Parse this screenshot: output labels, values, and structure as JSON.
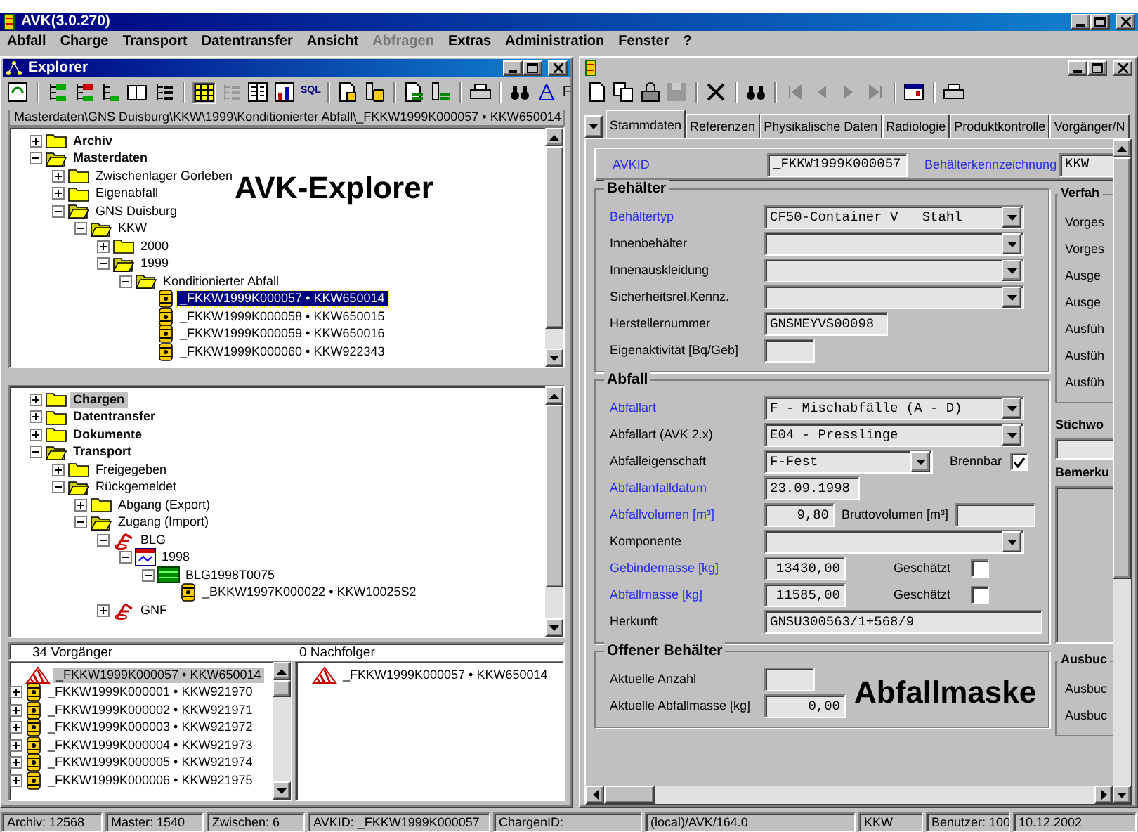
{
  "app": {
    "title": "AVK(3.0.270)"
  },
  "menu": [
    {
      "label": "Abfall",
      "disabled": false
    },
    {
      "label": "Charge",
      "disabled": false
    },
    {
      "label": "Transport",
      "disabled": false
    },
    {
      "label": "Datentransfer",
      "disabled": false
    },
    {
      "label": "Ansicht",
      "disabled": false
    },
    {
      "label": "Abfragen",
      "disabled": true
    },
    {
      "label": "Extras",
      "disabled": false
    },
    {
      "label": "Administration",
      "disabled": false
    },
    {
      "label": "Fenster",
      "disabled": false
    },
    {
      "label": "?",
      "disabled": false
    }
  ],
  "explorer": {
    "title": "Explorer",
    "toolbar_sql": "SQL",
    "toolbar_overflow": "F",
    "path": "Masterdaten\\GNS Duisburg\\KKW\\1999\\Konditionierter Abfall\\_FKKW1999K000057 • KKW650014",
    "overlay_label": "AVK-Explorer",
    "tree_top": {
      "focused": true,
      "nodes": [
        {
          "label": "Archiv",
          "kind": "folder",
          "bold": true,
          "expanded": false,
          "selected": false
        },
        {
          "label": "Masterdaten",
          "kind": "folder-open",
          "bold": true,
          "expanded": true,
          "selected": false,
          "children": [
            {
              "label": "Zwischenlager Gorleben",
              "kind": "folder",
              "bold": false,
              "expanded": false,
              "selected": false
            },
            {
              "label": "Eigenabfall",
              "kind": "folder",
              "bold": false,
              "expanded": false,
              "selected": false
            },
            {
              "label": "GNS Duisburg",
              "kind": "folder-open",
              "bold": false,
              "expanded": true,
              "selected": false,
              "children": [
                {
                  "label": "KKW",
                  "kind": "folder-open",
                  "bold": false,
                  "expanded": true,
                  "selected": false,
                  "children": [
                    {
                      "label": "2000",
                      "kind": "folder",
                      "bold": false,
                      "expanded": false,
                      "selected": false
                    },
                    {
                      "label": "1999",
                      "kind": "folder-open",
                      "bold": false,
                      "expanded": true,
                      "selected": false,
                      "children": [
                        {
                          "label": "Konditionierter Abfall",
                          "kind": "folder-open",
                          "bold": false,
                          "expanded": true,
                          "selected": false,
                          "children": [
                            {
                              "label": "_FKKW1999K000057 • KKW650014",
                              "kind": "drum",
                              "bold": false,
                              "selected": true
                            },
                            {
                              "label": "_FKKW1999K000058 • KKW650015",
                              "kind": "drum",
                              "bold": false,
                              "selected": false
                            },
                            {
                              "label": "_FKKW1999K000059 • KKW650016",
                              "kind": "drum",
                              "bold": false,
                              "selected": false
                            },
                            {
                              "label": "_FKKW1999K000060 • KKW922343",
                              "kind": "drum",
                              "bold": false,
                              "selected": false
                            }
                          ]
                        }
                      ]
                    }
                  ]
                }
              ]
            }
          ]
        }
      ]
    },
    "tree_bottom": {
      "focused": false,
      "nodes": [
        {
          "label": "Chargen",
          "kind": "folder",
          "bold": true,
          "expanded": false,
          "selected": true
        },
        {
          "label": "Datentransfer",
          "kind": "folder",
          "bold": true,
          "expanded": false,
          "selected": false
        },
        {
          "label": "Dokumente",
          "kind": "folder",
          "bold": true,
          "expanded": false,
          "selected": false
        },
        {
          "label": "Transport",
          "kind": "folder-open",
          "bold": true,
          "expanded": true,
          "selected": false,
          "children": [
            {
              "label": "Freigegeben",
              "kind": "folder",
              "bold": false,
              "expanded": false,
              "selected": false
            },
            {
              "label": "Rückgemeldet",
              "kind": "folder-open",
              "bold": false,
              "expanded": true,
              "selected": false,
              "children": [
                {
                  "label": "Abgang (Export)",
                  "kind": "folder",
                  "bold": false,
                  "expanded": false,
                  "selected": false
                },
                {
                  "label": "Zugang (Import)",
                  "kind": "folder-open",
                  "bold": false,
                  "expanded": true,
                  "selected": false,
                  "children": [
                    {
                      "label": "BLG",
                      "kind": "site",
                      "bold": false,
                      "expanded": true,
                      "selected": false,
                      "children": [
                        {
                          "label": "1998",
                          "kind": "calendar",
                          "bold": false,
                          "expanded": true,
                          "selected": false,
                          "children": [
                            {
                              "label": "BLG1998T0075",
                              "kind": "batch",
                              "bold": false,
                              "expanded": true,
                              "selected": false,
                              "children": [
                                {
                                  "label": "_BKKW1997K000022 • KKW10025S2",
                                  "kind": "drum",
                                  "bold": false,
                                  "selected": false
                                }
                              ]
                            }
                          ]
                        }
                      ]
                    },
                    {
                      "label": "GNF",
                      "kind": "site",
                      "bold": false,
                      "expanded": false,
                      "selected": false
                    }
                  ]
                }
              ]
            }
          ]
        }
      ]
    },
    "predecessors": {
      "header": "34 Vorgänger",
      "items": [
        {
          "label": "_FKKW1999K000057 • KKW650014",
          "kind": "hazard",
          "selected": true
        },
        {
          "label": "_FKKW1999K000001 • KKW921970",
          "kind": "drum",
          "expanded": false,
          "selected": false
        },
        {
          "label": "_FKKW1999K000002 • KKW921971",
          "kind": "drum",
          "expanded": false,
          "selected": false
        },
        {
          "label": "_FKKW1999K000003 • KKW921972",
          "kind": "drum",
          "expanded": false,
          "selected": false
        },
        {
          "label": "_FKKW1999K000004 • KKW921973",
          "kind": "drum",
          "expanded": false,
          "selected": false
        },
        {
          "label": "_FKKW1999K000005 • KKW921974",
          "kind": "drum",
          "expanded": false,
          "selected": false
        },
        {
          "label": "_FKKW1999K000006 • KKW921975",
          "kind": "drum",
          "expanded": false,
          "selected": false
        }
      ]
    },
    "successors": {
      "header": "0 Nachfolger",
      "items": [
        {
          "label": "_FKKW1999K000057 • KKW650014",
          "kind": "hazard",
          "selected": false
        }
      ]
    }
  },
  "form": {
    "tabs": [
      {
        "label": "Stammdaten",
        "selected": true
      },
      {
        "label": "Referenzen",
        "selected": false
      },
      {
        "label": "Physikalische Daten",
        "selected": false
      },
      {
        "label": "Radiologie",
        "selected": false
      },
      {
        "label": "Produktkontrolle",
        "selected": false
      },
      {
        "label": "Vorgänger/N",
        "selected": false
      }
    ],
    "id_row": {
      "label": "AVKID",
      "value": "_FKKW1999K000057",
      "label_2": "Behälterkennzeichnung",
      "value_2": "KKW"
    },
    "groups": [
      {
        "title": "Behälter",
        "rows": [
          {
            "label": "Behältertyp",
            "required": true,
            "kind": "combo",
            "value": "CF50-Container V   Stahl"
          },
          {
            "label": "Innenbehälter",
            "required": false,
            "kind": "combo"
          },
          {
            "label": "Innenauskleidung",
            "required": false,
            "kind": "combo"
          },
          {
            "label": "Sicherheitsrel.Kennz.",
            "required": false,
            "kind": "combo"
          },
          {
            "label": "Herstellernummer",
            "required": false,
            "kind": "text",
            "value": "GNSMEYVS00098"
          },
          {
            "label": "Eigenaktivität [Bq/Geb]",
            "required": false,
            "kind": "short"
          }
        ]
      },
      {
        "title": "Abfall",
        "rows": [
          {
            "label": "Abfallart",
            "required": true,
            "kind": "combo",
            "value": "F - Mischabfälle (A - D)"
          },
          {
            "label": "Abfallart (AVK 2.x)",
            "required": false,
            "kind": "combo",
            "value": "E04 - Presslinge"
          },
          {
            "label": "Abfalleigenschaft",
            "required": false,
            "kind": "combo-check",
            "value": "F-Fest",
            "check_label": "Brennbar",
            "checked": true
          },
          {
            "label": "Abfallanfalldatum",
            "required": true,
            "kind": "date",
            "value": "23.09.1998"
          },
          {
            "label": "Abfallvolumen [m³]",
            "required": true,
            "kind": "number-pair",
            "value": "9,80",
            "label_2": "Bruttovolumen [m³]"
          },
          {
            "label": "Komponente",
            "required": false,
            "kind": "combo"
          },
          {
            "label": "Gebindemasse [kg]",
            "required": true,
            "kind": "number-check",
            "value": "13430,00",
            "check_label": "Geschätzt",
            "checked": false
          },
          {
            "label": "Abfallmasse [kg]",
            "required": true,
            "kind": "number-check",
            "value": "11585,00",
            "check_label": "Geschätzt",
            "checked": false
          },
          {
            "label": "Herkunft",
            "required": false,
            "kind": "wide",
            "value": "GNSU300563/1+568/9"
          }
        ]
      },
      {
        "title": "Offener Behälter",
        "overlay_label": "Abfallmaske",
        "rows": [
          {
            "label": "Aktuelle Anzahl",
            "required": false,
            "kind": "short"
          },
          {
            "label": "Aktuelle Abfallmasse [kg]",
            "required": false,
            "kind": "number",
            "value": "0,00"
          }
        ]
      }
    ],
    "side": {
      "group_title": "Verfah",
      "group_labels": [
        "Vorges",
        "Vorges",
        "Ausge",
        "Ausge",
        "Ausfüh",
        "Ausfüh",
        "Ausfüh"
      ],
      "keyword_label": "Stichwo",
      "remark_label": "Bemerku",
      "group_2_title": "Ausbuc",
      "group_2_labels": [
        "Ausbuc",
        "Ausbuc"
      ]
    }
  },
  "status_bar": [
    "Archiv: 12568",
    "Master: 1540",
    "Zwischen: 6",
    "AVKID: _FKKW1999K000057",
    "ChargenID:",
    "(local)/AVK/164.0",
    "KKW",
    "Benutzer: 100",
    "10.12.2002"
  ]
}
